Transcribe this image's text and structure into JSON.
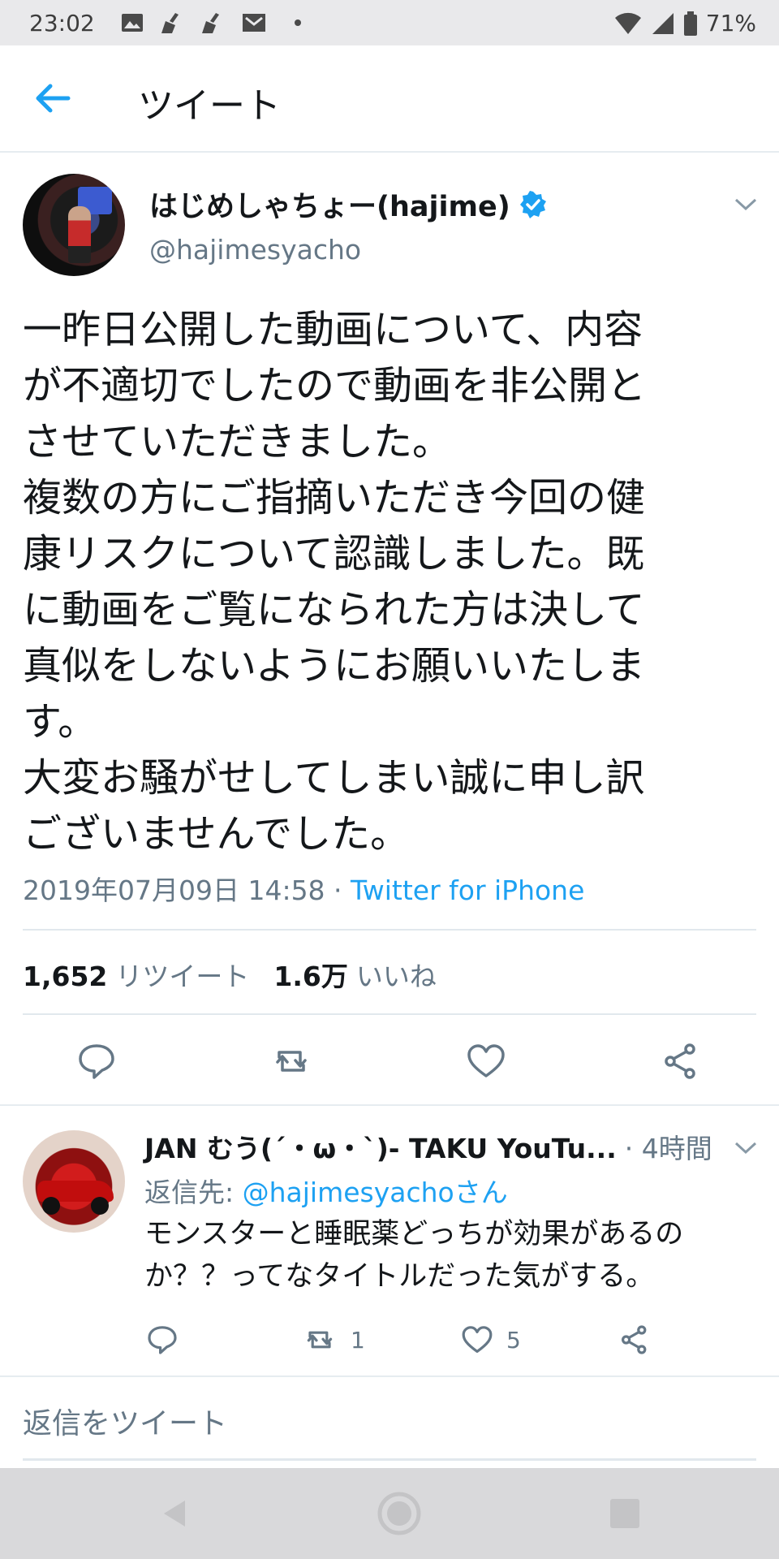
{
  "status_bar": {
    "time": "23:02",
    "battery": "71%",
    "left_icons": [
      "image-icon",
      "broom-icon",
      "broom-icon",
      "mail-icon",
      "dot-icon"
    ],
    "right_icons": [
      "wifi-icon",
      "signal-icon",
      "battery-icon"
    ]
  },
  "header": {
    "title": "ツイート",
    "back_icon": "arrow-left-icon"
  },
  "tweet": {
    "display_name": "はじめしゃちょー(hajime)",
    "verified": true,
    "handle": "@hajimesyacho",
    "text": "一昨日公開した動画について、内容\nが不適切でしたので動画を非公開と\nさせていただきました。\n複数の方にご指摘いただき今回の健\n康リスクについて認識しました。既\nに動画をご覧になられた方は決して\n真似をしないようにお願いいたしま\nす。\n大変お騒がせしてしまい誠に申し訳\nございませんでした。",
    "timestamp": "2019年07月09日 14:58",
    "separator": " · ",
    "source": "Twitter for iPhone",
    "retweet_count": "1,652",
    "retweet_label": "リツイート",
    "like_count": "1.6万",
    "like_label": "いいね"
  },
  "reply": {
    "display_name": "JAN むう(´・ω・`)- TAKU YouTu...",
    "time": "· 4時間",
    "reply_to_prefix": "返信先: ",
    "reply_to_mention": "@hajimesyachoさん",
    "text": "モンスターと睡眠薬どっちが効果があるの\nか？？ってなタイトルだった気がする。",
    "retweet_count": "1",
    "like_count": "5"
  },
  "compose": {
    "placeholder": "返信をツイート"
  },
  "colors": {
    "accent": "#1da1f2",
    "secondary_text": "#657786",
    "primary_text": "#14171a",
    "divider": "#e1e8ed",
    "status_bar_bg": "#e9e9eb",
    "nav_bar_bg": "#d9d9db"
  }
}
